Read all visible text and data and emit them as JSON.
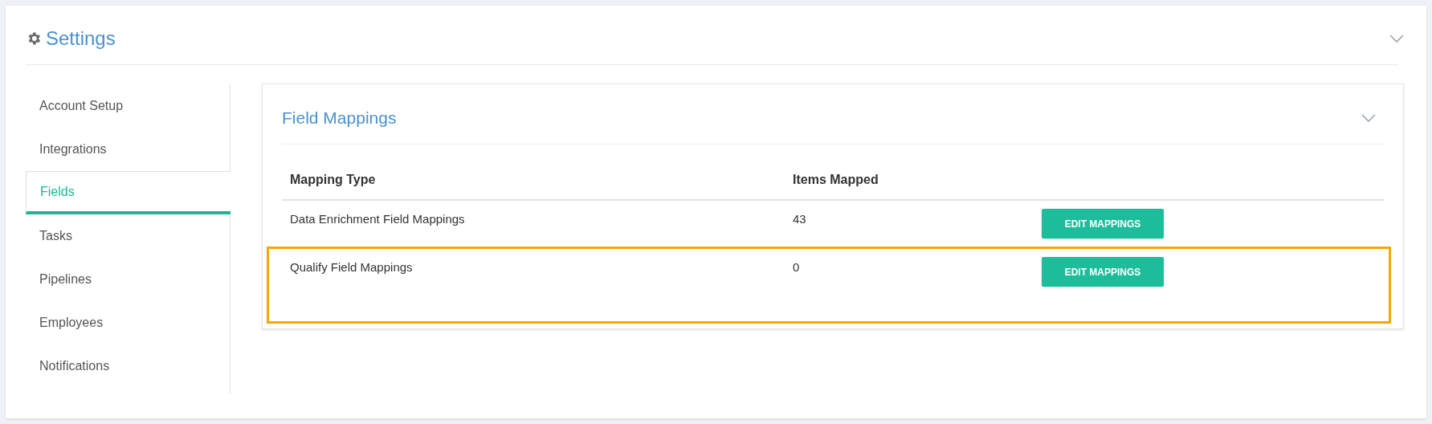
{
  "header": {
    "title": "Settings"
  },
  "sidebar": {
    "items": [
      {
        "label": "Account Setup",
        "selected": false
      },
      {
        "label": "Integrations",
        "selected": false
      },
      {
        "label": "Fields",
        "selected": true
      },
      {
        "label": "Tasks",
        "selected": false
      },
      {
        "label": "Pipelines",
        "selected": false
      },
      {
        "label": "Employees",
        "selected": false
      },
      {
        "label": "Notifications",
        "selected": false
      }
    ]
  },
  "panel": {
    "title": "Field Mappings",
    "table": {
      "columns": [
        "Mapping Type",
        "Items Mapped"
      ],
      "rows": [
        {
          "mapping_type": "Data Enrichment Field Mappings",
          "items_mapped": "43",
          "action": "EDIT MAPPINGS",
          "highlighted": false
        },
        {
          "mapping_type": "Qualify Field Mappings",
          "items_mapped": "0",
          "action": "EDIT MAPPINGS",
          "highlighted": true
        }
      ]
    }
  }
}
